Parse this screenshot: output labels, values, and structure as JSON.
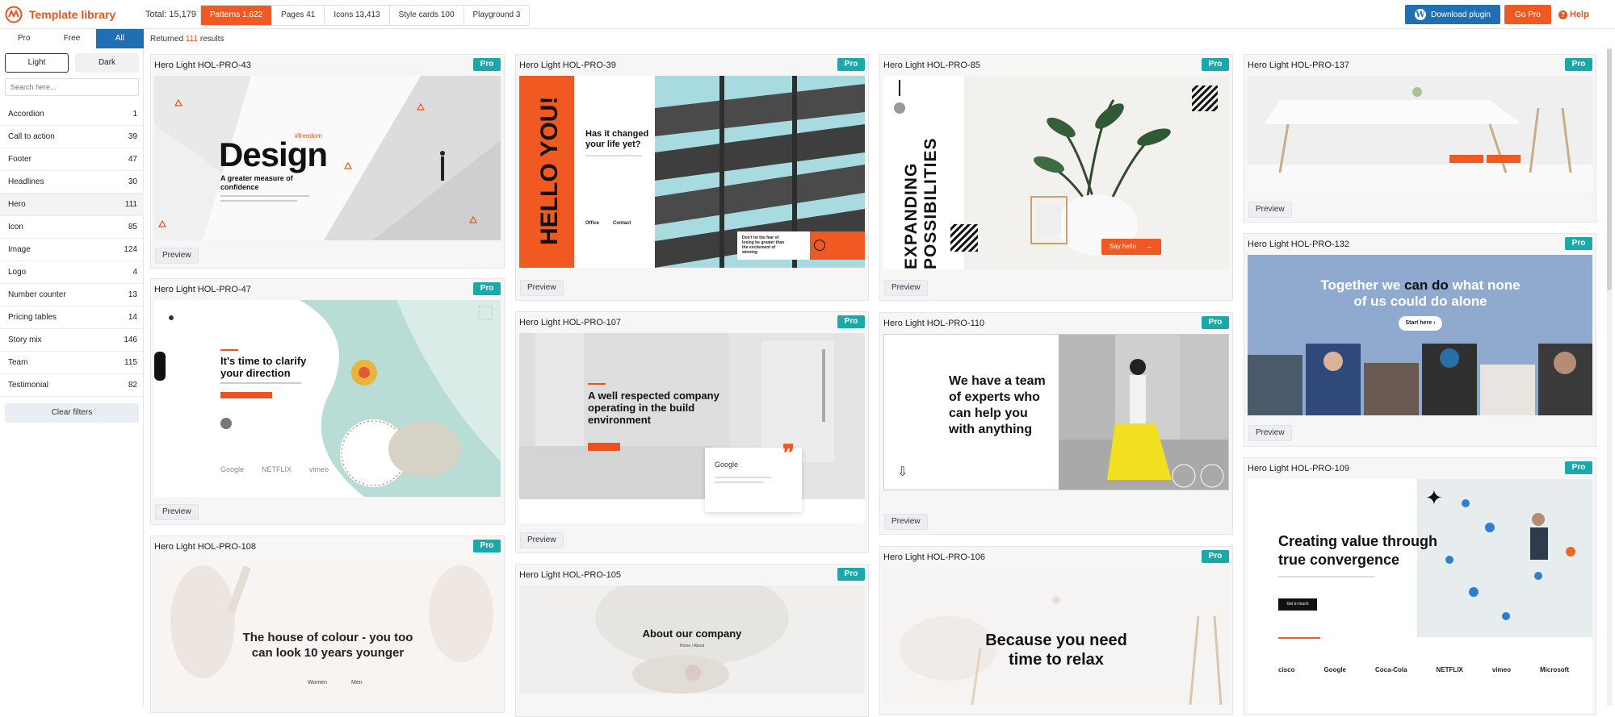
{
  "app": {
    "title": "Template library"
  },
  "topbar": {
    "total": "Total: 15,179",
    "tabs": [
      {
        "label": "Patterns 1,622",
        "active": true
      },
      {
        "label": "Pages 41",
        "active": false
      },
      {
        "label": "Icons 13,413",
        "active": false
      },
      {
        "label": "Style cards 100",
        "active": false
      },
      {
        "label": "Playground 3",
        "active": false
      }
    ],
    "download_label": "Download plugin",
    "go_pro_label": "Go Pro",
    "help_label": "Help"
  },
  "filters": {
    "tabs": [
      {
        "label": "Pro",
        "active": false
      },
      {
        "label": "Free",
        "active": false
      },
      {
        "label": "All",
        "active": true
      }
    ],
    "returned_prefix": "Returned",
    "returned_count": "111",
    "returned_suffix": "results"
  },
  "sidebar": {
    "modes": [
      {
        "label": "Light",
        "active": true
      },
      {
        "label": "Dark",
        "active": false
      }
    ],
    "search_placeholder": "Search here...",
    "categories": [
      {
        "label": "Accordion",
        "count": "1"
      },
      {
        "label": "Call to action",
        "count": "39"
      },
      {
        "label": "Footer",
        "count": "47"
      },
      {
        "label": "Headlines",
        "count": "30"
      },
      {
        "label": "Hero",
        "count": "111",
        "active": true
      },
      {
        "label": "Icon",
        "count": "85"
      },
      {
        "label": "Image",
        "count": "124"
      },
      {
        "label": "Logo",
        "count": "4"
      },
      {
        "label": "Number counter",
        "count": "13"
      },
      {
        "label": "Pricing tables",
        "count": "14"
      },
      {
        "label": "Story mix",
        "count": "146"
      },
      {
        "label": "Team",
        "count": "115"
      },
      {
        "label": "Testimonial",
        "count": "82"
      }
    ],
    "clear_label": "Clear filters"
  },
  "cards": {
    "badge": "Pro",
    "preview_label": "Preview",
    "c43": {
      "title": "Hero Light HOL-PRO-43",
      "tag": "#freedom",
      "headline": "Design",
      "sub": "A greater measure of confidence"
    },
    "c47": {
      "title": "Hero Light HOL-PRO-47",
      "headline": "It's time to clarify your direction",
      "logos": [
        "Google",
        "NETFLIX",
        "vimeo"
      ]
    },
    "c108": {
      "title": "Hero Light HOL-PRO-108",
      "headline": "The house of colour - you too can look 10 years younger",
      "links": [
        "Women",
        "Men"
      ]
    },
    "c39": {
      "title": "Hero Light HOL-PRO-39",
      "vertical": "HELLO YOU!",
      "headline": "Has it changed your life yet?",
      "office": "Office",
      "contact": "Contact",
      "cta": "Don't let the fear of losing be greater than the excitement of winning"
    },
    "c107": {
      "title": "Hero Light HOL-PRO-107",
      "headline": "A well respected company operating in the build environment",
      "review_brand": "Google"
    },
    "c105": {
      "title": "Hero Light HOL-PRO-105",
      "headline": "About our company",
      "crumb": "Home / About"
    },
    "c85": {
      "title": "Hero Light HOL-PRO-85",
      "vertical": "EXPANDING POSSIBILITIES",
      "cta": "Say hello"
    },
    "c110": {
      "title": "Hero Light HOL-PRO-110",
      "headline": "We have a team of experts who can help you with anything"
    },
    "c106": {
      "title": "Hero Light HOL-PRO-106",
      "headline": "Because you need time to relax"
    },
    "c137": {
      "title": "Hero Light HOL-PRO-137"
    },
    "c132": {
      "title": "Hero Light HOL-PRO-132",
      "headline_a": "Together we ",
      "headline_b": "can do",
      "headline_c": " what none of us could do alone",
      "cta": "Start here"
    },
    "c109": {
      "title": "Hero Light HOL-PRO-109",
      "headline": "Creating value through true convergence",
      "cta": "Get in touch",
      "logos": [
        "cisco",
        "Google",
        "Coca-Cola",
        "NETFLIX",
        "vimeo",
        "Microsoft"
      ]
    }
  },
  "colors": {
    "accent": "#f05a22",
    "brand_blue": "#1f6fb5",
    "badge": "#1aa8a8"
  }
}
